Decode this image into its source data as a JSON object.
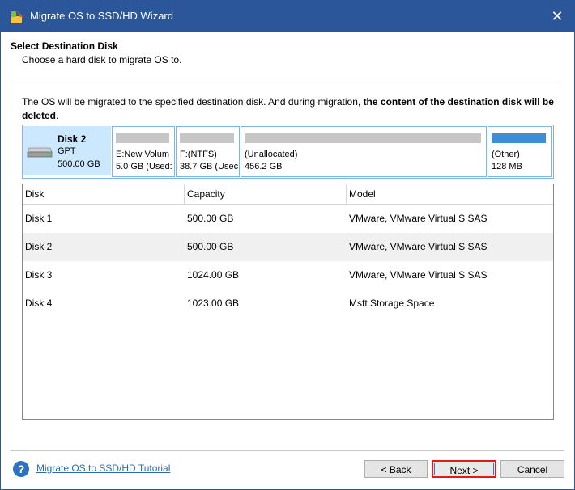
{
  "window": {
    "title": "Migrate OS to SSD/HD Wizard"
  },
  "header": {
    "title": "Select Destination Disk",
    "subtitle": "Choose a hard disk to migrate OS to."
  },
  "info": {
    "text_normal": "The OS will be migrated to the specified destination disk. And during migration, ",
    "text_bold": "the content of the destination disk will be deleted",
    "text_end": "."
  },
  "disk_map": {
    "disk_name": "Disk 2",
    "disk_type": "GPT",
    "disk_size": "500.00 GB",
    "partitions": [
      {
        "label": "E:New Volum",
        "size": "5.0 GB (Used:",
        "bar_color": "#c6c6c6"
      },
      {
        "label": "F:(NTFS)",
        "size": "38.7 GB (Usec",
        "bar_color": "#c6c6c6"
      },
      {
        "label": "(Unallocated)",
        "size": "456.2 GB",
        "bar_color": "#c6c6c6"
      },
      {
        "label": "(Other)",
        "size": "128 MB",
        "bar_color": "#3d8ed8"
      }
    ]
  },
  "table": {
    "columns": [
      "Disk",
      "Capacity",
      "Model"
    ],
    "rows": [
      {
        "disk": "Disk 1",
        "capacity": "500.00 GB",
        "model": "VMware, VMware Virtual S SAS",
        "selected": false
      },
      {
        "disk": "Disk 2",
        "capacity": "500.00 GB",
        "model": "VMware, VMware Virtual S SAS",
        "selected": true
      },
      {
        "disk": "Disk 3",
        "capacity": "1024.00 GB",
        "model": "VMware, VMware Virtual S SAS",
        "selected": false
      },
      {
        "disk": "Disk 4",
        "capacity": "1023.00 GB",
        "model": "Msft Storage Space",
        "selected": false
      }
    ]
  },
  "footer": {
    "tutorial_link": "Migrate OS to SSD/HD Tutorial",
    "back_label": "< Back",
    "next_label": "Next >",
    "cancel_label": "Cancel"
  },
  "icons": {
    "app": "wizard-app-icon",
    "close": "close-icon",
    "disk": "hard-disk-icon",
    "help": "help-icon"
  },
  "colors": {
    "titlebar": "#2b579a",
    "selection": "#cce8ff",
    "accent": "#3d8ed8",
    "highlight": "#e21a1a"
  }
}
